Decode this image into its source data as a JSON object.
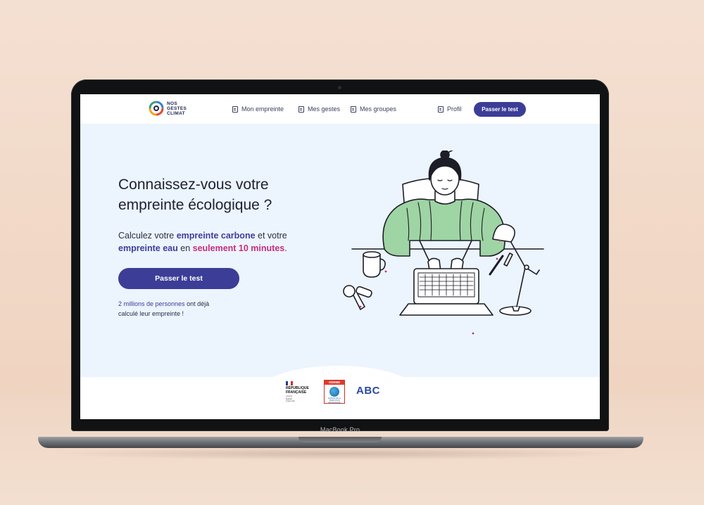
{
  "device": {
    "model_label": "MacBook Pro"
  },
  "nav": {
    "logo_lines": [
      "NOS",
      "GESTES",
      "CLIMAT"
    ],
    "links": [
      {
        "label": "Mon empreinte",
        "icon": "document-icon"
      },
      {
        "label": "Mes gestes",
        "icon": "document-icon"
      },
      {
        "label": "Mes groupes",
        "icon": "document-icon"
      },
      {
        "label": "Profil",
        "icon": "document-icon"
      }
    ],
    "cta_label": "Passer le test"
  },
  "hero": {
    "title_line1": "Connaissez-vous votre",
    "title_line2": "empreinte écologique ?",
    "subtitle": {
      "part1": "Calculez votre ",
      "hl1": "empreinte carbone",
      "part2": " et votre ",
      "hl2": "empreinte eau",
      "part3": " en ",
      "hl3": "seulement 10 minutes",
      "part4": "."
    },
    "cta_label": "Passer le test",
    "note": {
      "hl": "2 millions de personnes",
      "rest_line1": " ont déjà",
      "line2": "calculé leur empreinte !"
    },
    "illustration": "woman-typing-on-laptop-illustration"
  },
  "partners": {
    "republique": {
      "line1": "RÉPUBLIQUE",
      "line2": "FRANÇAISE",
      "motto": [
        "Liberté",
        "Égalité",
        "Fraternité"
      ]
    },
    "ademe": {
      "label": "ADEME",
      "foot": "AGENCE DE LA TRANSITION ÉCOLOGIQUE"
    },
    "abc": {
      "label": "ABC"
    }
  },
  "colors": {
    "primary": "#3c3d96",
    "accent_pink": "#c52d7c",
    "hero_bg": "#ecf4fe",
    "text_dark": "#1d2033"
  }
}
